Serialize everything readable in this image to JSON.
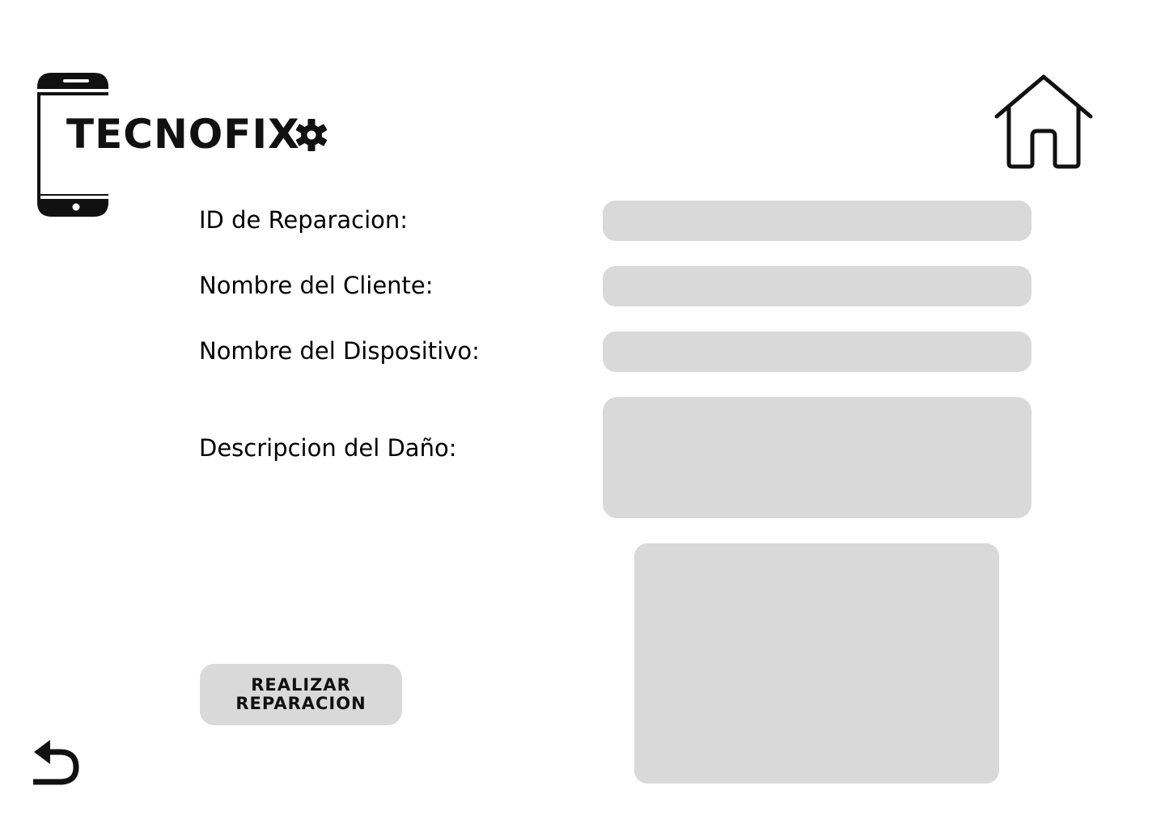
{
  "brand": {
    "name": "TECNOFIX",
    "icons": [
      "smartphone-icon",
      "gear-icon"
    ]
  },
  "navigation": {
    "home_icon": "home-icon",
    "back_icon": "undo-arrow-icon"
  },
  "form": {
    "fields": [
      {
        "label": "ID de Reparacion:",
        "value": ""
      },
      {
        "label": "Nombre del Cliente:",
        "value": ""
      },
      {
        "label": "Nombre del Dispositivo:",
        "value": ""
      },
      {
        "label": "Descripcion del Daño:",
        "value": ""
      }
    ],
    "submit_label": "REALIZAR\nREPARACION"
  },
  "colors": {
    "background": "#ffffff",
    "field_fill": "#d9d9d9",
    "text": "#000000"
  }
}
